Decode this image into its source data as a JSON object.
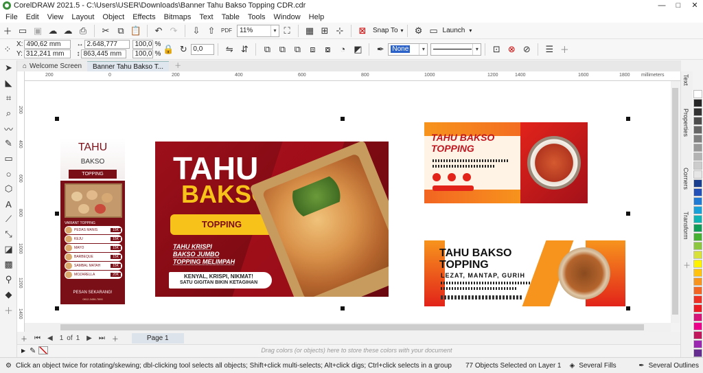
{
  "window": {
    "title": "CorelDRAW 2021.5 - C:\\Users\\USER\\Downloads\\Banner Tahu Bakso Topping CDR.cdr",
    "min": "—",
    "max": "□",
    "close": "✕"
  },
  "menu": [
    "File",
    "Edit",
    "View",
    "Layout",
    "Object",
    "Effects",
    "Bitmaps",
    "Text",
    "Table",
    "Tools",
    "Window",
    "Help"
  ],
  "toolbar1": {
    "zoom": "11%",
    "snap_to": "Snap To",
    "launch": "Launch"
  },
  "toolbar2": {
    "x": "490,62 mm",
    "y": "312,241 mm",
    "w": "2.648,777 mm",
    "h": "863,445 mm",
    "sx": "100,0",
    "sy": "100,0",
    "pct1": "%",
    "pct2": "%",
    "angle": "0,0",
    "outline": "None"
  },
  "tabs": [
    {
      "label": "Welcome Screen"
    },
    {
      "label": "Banner Tahu Bakso T..."
    }
  ],
  "ruler": {
    "units": "millimeters",
    "h_ticks": [
      "200",
      "0",
      "200",
      "400",
      "600",
      "800",
      "1000",
      "1200",
      "1400",
      "1600",
      "1800",
      "2000"
    ],
    "v_ticks": [
      "200",
      "400",
      "600",
      "800",
      "1000",
      "1200",
      "1400"
    ]
  },
  "page_nav": {
    "current": "1",
    "of": "of",
    "total": "1",
    "tab": "Page 1"
  },
  "colorbar_hint": "Drag colors (or objects) here to store these colors with your document",
  "status": {
    "hint": "Click an object twice for rotating/skewing; dbl-clicking tool selects all objects; Shift+click multi-selects; Alt+click digs; Ctrl+click selects in a group",
    "selection": "77 Objects Selected on Layer 1",
    "fill": "Several Fills",
    "outline": "Several Outlines"
  },
  "dockers": [
    "Text",
    "Properties",
    "Corners",
    "Transform"
  ],
  "palette": [
    "#ffffff",
    "#262626",
    "#333333",
    "#4d4d4d",
    "#666666",
    "#808080",
    "#999999",
    "#b3b3b3",
    "#cccccc",
    "#e6e6e6",
    "#1b3f8f",
    "#2451b8",
    "#1f7bd4",
    "#18a0d8",
    "#10b3b3",
    "#0f9d58",
    "#46b030",
    "#8dc63f",
    "#d8e13a",
    "#fff200",
    "#ffc20e",
    "#f7941d",
    "#f26522",
    "#ee3124",
    "#ed1c24",
    "#d7147a",
    "#ec008c",
    "#c2185b",
    "#9c27b0",
    "#662d91"
  ],
  "banners": {
    "vertical": {
      "title": "TAHU",
      "sub": "BAKSO",
      "tag": "TOPPING",
      "menu_title": "VARIANT TOPPING",
      "items": [
        {
          "name": "PEDAS MANIS",
          "price": "15K"
        },
        {
          "name": "KEJU",
          "price": "15K"
        },
        {
          "name": "MAYO",
          "price": "15K"
        },
        {
          "name": "BARBEQUE",
          "price": "15K"
        },
        {
          "name": "SAMBAL MATAH",
          "price": "15K"
        },
        {
          "name": "MOZARELLA",
          "price": "20K"
        }
      ],
      "cta": "PESAN SEKARANG!",
      "contact": "0812-3456-7890"
    },
    "main": {
      "title1": "TAHU",
      "title2": "BAKSO",
      "badge": "TOPPING",
      "features": [
        "TAHU KRISPI",
        "BAKSO JUMBO",
        "TOPPING MELIMPAH"
      ],
      "tagline1": "KENYAL, KRISPI, NIKMAT!",
      "tagline2": "SATU GIGITAN BIKIN KETAGIHAN"
    },
    "right_top": {
      "title1": "TAHU BAKSO",
      "title2": "TOPPING"
    },
    "right_bottom": {
      "title1": "TAHU BAKSO",
      "title2": "TOPPING",
      "sub": "LEZAT, MANTAP, GURIH"
    }
  }
}
